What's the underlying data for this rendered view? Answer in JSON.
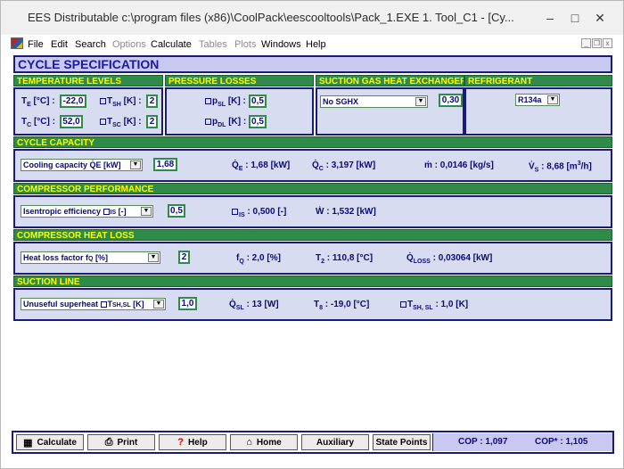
{
  "window": {
    "title": "EES Distributable  c:\\program files (x86)\\CoolPack\\eescooltools\\Pack_1.EXE   1. Tool_C1 - [Cy...",
    "controls": {
      "minimize": "–",
      "maximize": "□",
      "close": "✕"
    }
  },
  "menu": {
    "items": [
      {
        "label": "File",
        "enabled": true
      },
      {
        "label": "Edit",
        "enabled": true
      },
      {
        "label": "Search",
        "enabled": true
      },
      {
        "label": "Options",
        "enabled": false
      },
      {
        "label": "Calculate",
        "enabled": true
      },
      {
        "label": "Tables",
        "enabled": false
      },
      {
        "label": "Plots",
        "enabled": false
      },
      {
        "label": "Windows",
        "enabled": true
      },
      {
        "label": "Help",
        "enabled": true
      }
    ]
  },
  "cycle": {
    "title": "CYCLE SPECIFICATION",
    "temperature_levels": {
      "header": "TEMPERATURE LEVELS",
      "te_label": "T",
      "te_sub": "E",
      "te_unit": " [°C] :",
      "te_value": "-22,0",
      "tsh_label": "T",
      "tsh_sub": "SH",
      "tsh_unit": " [K] :",
      "tsh_value": "2",
      "tc_label": "T",
      "tc_sub": "C",
      "tc_unit": " [°C] :",
      "tc_value": "52,0",
      "tsc_label": "T",
      "tsc_sub": "SC",
      "tsc_unit": " [K] :",
      "tsc_value": "2"
    },
    "pressure_losses": {
      "header": "PRESSURE LOSSES",
      "psl_label": "p",
      "psl_sub": "SL",
      "psl_unit": " [K] :",
      "psl_value": "0,5",
      "pdl_label": "p",
      "pdl_sub": "DL",
      "pdl_unit": " [K] :",
      "pdl_value": "0,5"
    },
    "sghx": {
      "header": "SUCTION GAS HEAT EXCHANGER",
      "selected": "No SGHX",
      "value": "0,30"
    },
    "refrigerant": {
      "header": "REFRIGERANT",
      "selected": "R134a"
    },
    "capacity": {
      "header": "CYCLE CAPACITY",
      "selected": "Cooling capacity Q̇E [kW]",
      "value": "1,68",
      "qe_label": "Q̇",
      "qe_sub": "E",
      "qe_text": " : 1,68 [kW]",
      "qc_label": "Q̇",
      "qc_sub": "C",
      "qc_text": " : 3,197 [kW]",
      "m_text": "ṁ : 0,0146 [kg/s]",
      "vs_label": "V̇",
      "vs_sub": "S",
      "vs_text": " : 8,68 [m",
      "vs_sup": "3",
      "vs_tail": "/h]"
    },
    "compressor": {
      "header": "COMPRESSOR PERFORMANCE",
      "selected": "Isentropic efficiency ",
      "selected_sub": "IS",
      "selected_tail": " [-]",
      "value": "0,5",
      "eta_sub": "IS",
      "eta_text": " : 0,500 [-]",
      "w_text": "Ẇ : 1,532 [kW]"
    },
    "heatloss": {
      "header": "COMPRESSOR HEAT LOSS",
      "selected": "Heat loss factor f",
      "selected_sub": "Q",
      "selected_tail": " [%]",
      "value": "2",
      "fq_label": "f",
      "fq_sub": "Q",
      "fq_text": " : 2,0 [%]",
      "t2_label": "T",
      "t2_sub": "2",
      "t2_text": " : 110,8 [°C]",
      "qloss_label": "Q̇",
      "qloss_sub": "LOSS",
      "qloss_text": " : 0,03064 [kW]"
    },
    "suction": {
      "header": "SUCTION LINE",
      "selected": "Unuseful superheat ",
      "selected_mid": "T",
      "selected_sub": "SH,SL",
      "selected_tail": " [K]",
      "value": "1,0",
      "qsl_label": "Q̇",
      "qsl_sub": "SL",
      "qsl_text": " : 13 [W]",
      "t8_label": "T",
      "t8_sub": "8",
      "t8_text": " : -19,0 [°C]",
      "tshsl_label": "T",
      "tshsl_sub": "SH, SL",
      "tshsl_text": " : 1,0 [K]"
    }
  },
  "toolbar": {
    "calculate": "Calculate",
    "print": "Print",
    "help": "Help",
    "home": "Home",
    "auxiliary": "Auxiliary",
    "state_points": "State Points",
    "cop": "COP : 1,097",
    "cop_star": "COP* : 1,105"
  },
  "colors": {
    "section_header_bg": "#2e8b4a",
    "section_header_text": "#ffff00",
    "panel_bg": "#d8dcf0",
    "title_bg": "#c8c8f0",
    "border": "#1a1a78",
    "label_text": "#0a0a7a"
  }
}
